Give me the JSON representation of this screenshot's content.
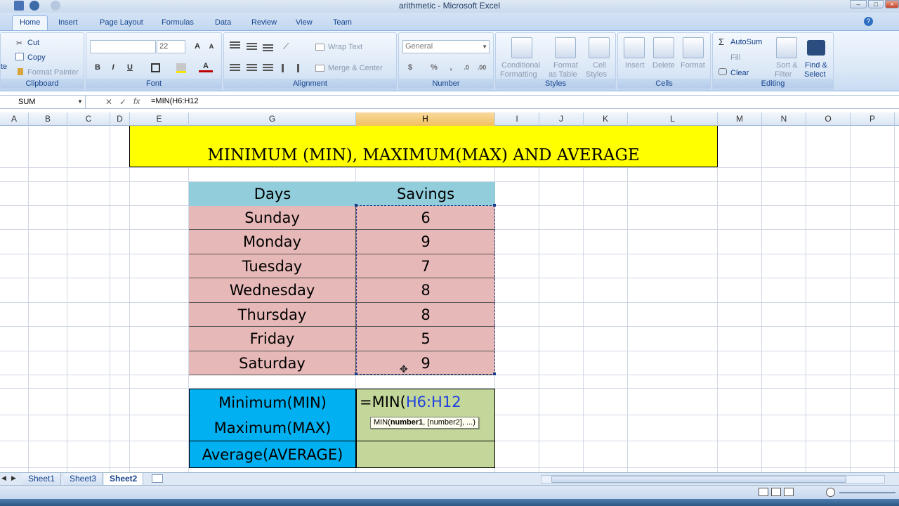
{
  "window": {
    "title": "arithmetic - Microsoft Excel"
  },
  "tabs": [
    "Home",
    "Insert",
    "Page Layout",
    "Formulas",
    "Data",
    "Review",
    "View",
    "Team"
  ],
  "ribbon": {
    "clipboard": {
      "label": "Clipboard",
      "paste": "te",
      "cut": "Cut",
      "copy": "Copy",
      "format_painter": "Format Painter"
    },
    "font": {
      "label": "Font",
      "font_name": "",
      "font_size": "22",
      "bold": "B",
      "italic": "I",
      "underline": "U"
    },
    "alignment": {
      "label": "Alignment",
      "wrap_text": "Wrap Text",
      "merge_center": "Merge & Center"
    },
    "number": {
      "label": "Number",
      "format": "General",
      "currency": "$",
      "percent": "%"
    },
    "styles": {
      "label": "Styles",
      "conditional": "Conditional",
      "formatting": "Formatting",
      "format_as": "Format",
      "as_table": "as Table",
      "cell": "Cell",
      "cell_styles": "Styles"
    },
    "cells": {
      "label": "Cells",
      "insert": "Insert",
      "delete": "Delete",
      "format": "Format"
    },
    "editing": {
      "label": "Editing",
      "autosum": "AutoSum",
      "fill": "Fill",
      "clear": "Clear",
      "sort": "Sort &",
      "filter": "Filter",
      "find": "Find &",
      "select": "Select"
    }
  },
  "formula_bar": {
    "name_box": "SUM",
    "formula": "=MIN(H6:H12"
  },
  "columns": [
    "A",
    "B",
    "C",
    "D",
    "E",
    "G",
    "H",
    "I",
    "J",
    "K",
    "L",
    "M",
    "N",
    "O",
    "P"
  ],
  "sheet": {
    "title": "MINIMUM (MIN), MAXIMUM(MAX) AND AVERAGE",
    "header_days": "Days",
    "header_savings": "Savings",
    "rows": [
      {
        "day": "Sunday",
        "savings": "6"
      },
      {
        "day": "Monday",
        "savings": "9"
      },
      {
        "day": "Tuesday",
        "savings": "7"
      },
      {
        "day": "Wednesday",
        "savings": "8"
      },
      {
        "day": "Thursday",
        "savings": "8"
      },
      {
        "day": "Friday",
        "savings": "5"
      },
      {
        "day": "Saturday",
        "savings": "9"
      }
    ],
    "min_label": "Minimum(MIN)",
    "max_label": "Maximum(MAX)",
    "avg_label": "Average(AVERAGE)",
    "editing_prefix": "=MIN(",
    "editing_ref": "H6:H12",
    "tooltip_fn": "MIN(",
    "tooltip_arg1": "number1",
    "tooltip_rest": ", [number2], ...)"
  },
  "sheet_tabs": [
    "Sheet1",
    "Sheet3",
    "Sheet2"
  ],
  "active_sheet": "Sheet2",
  "colors": {
    "title_fill": "#ffff00",
    "header_fill": "#92cddc",
    "row_fill": "#e6b8b7",
    "label_fill": "#00b0f0",
    "result_fill": "#c4d79b",
    "ref_text": "#1f3fdf"
  }
}
